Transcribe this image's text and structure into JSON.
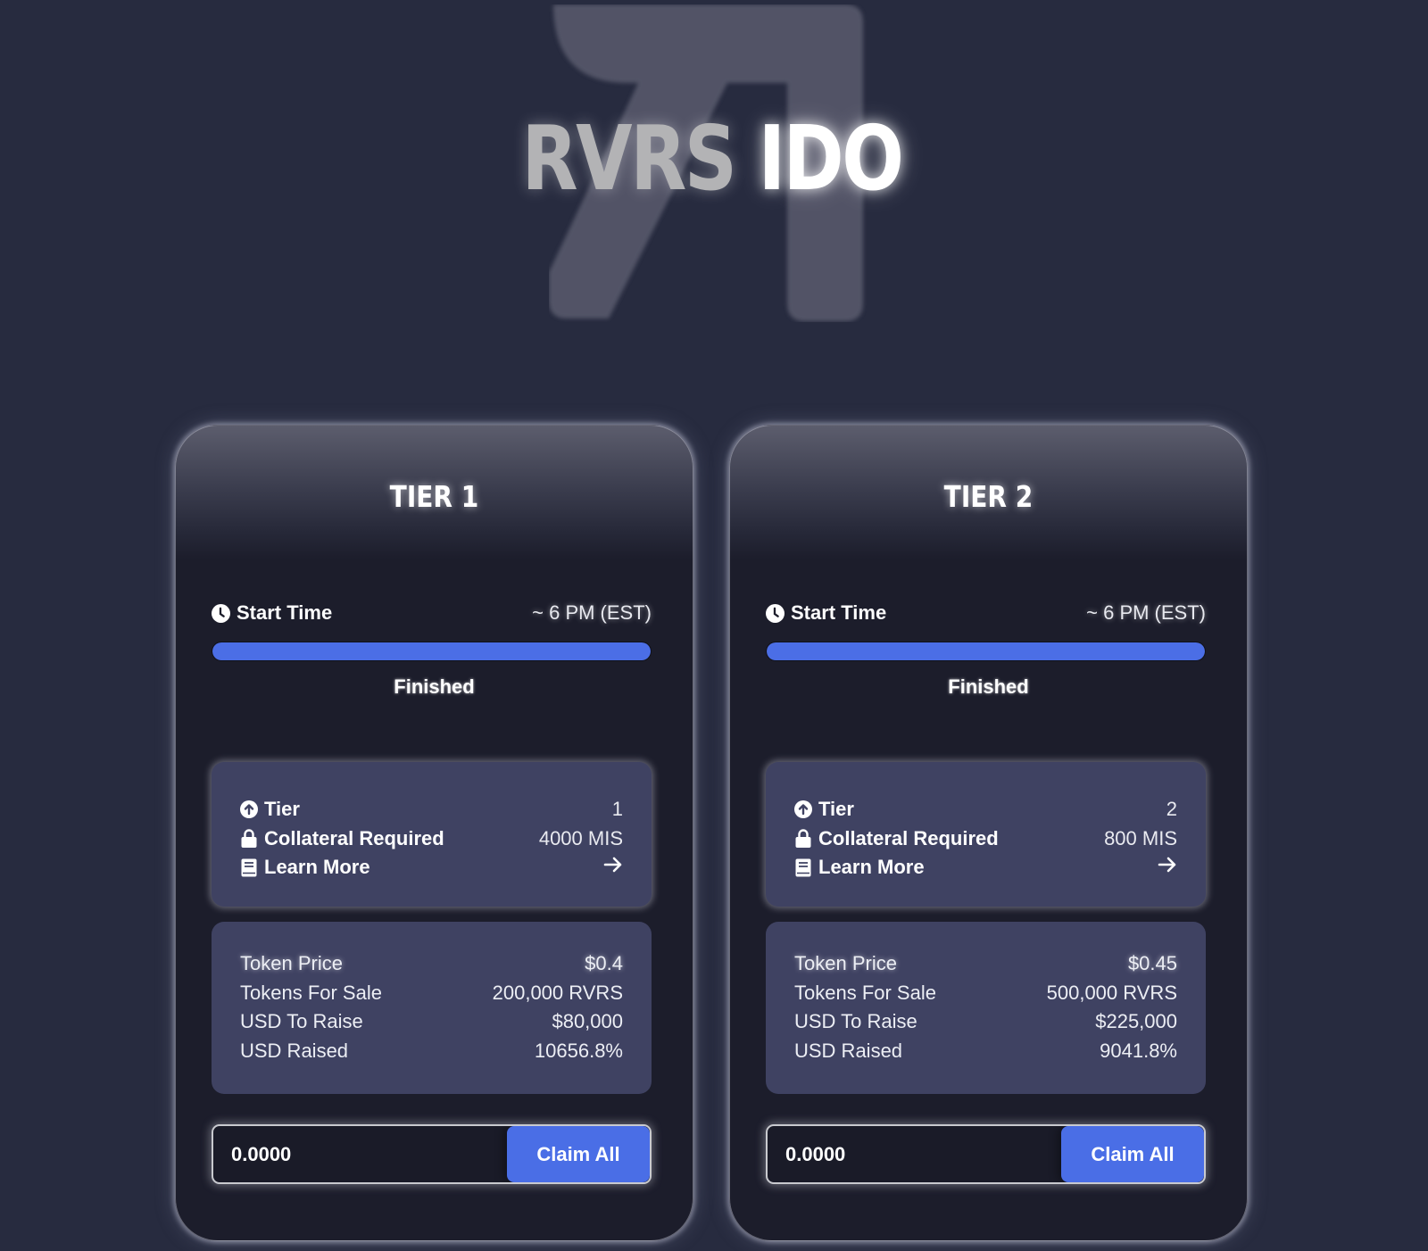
{
  "header": {
    "title_part1": "RVRS",
    "title_part2": "IDO",
    "logo_icon": "rvrs-logo"
  },
  "colors": {
    "background": "#272b3f",
    "card": "#1c1d2b",
    "panel": "#3f4262",
    "accent": "#4a6ee6"
  },
  "tiers": [
    {
      "title": "TIER 1",
      "start_label": "Start Time",
      "start_value": "~ 6 PM (EST)",
      "progress_percent": 100,
      "status": "Finished",
      "info": {
        "tier_label": "Tier",
        "tier_value": "1",
        "collateral_label": "Collateral Required",
        "collateral_value": "4000 MIS",
        "learn_more_label": "Learn More",
        "learn_more_icon": "arrow-right"
      },
      "stats": [
        {
          "label": "Token Price",
          "value": "$0.4"
        },
        {
          "label": "Tokens For Sale",
          "value": "200,000 RVRS"
        },
        {
          "label": "USD To Raise",
          "value": "$80,000"
        },
        {
          "label": "USD Raised",
          "value": "10656.8%"
        }
      ],
      "claim": {
        "amount": "0.0000",
        "button_label": "Claim All"
      }
    },
    {
      "title": "TIER 2",
      "start_label": "Start Time",
      "start_value": "~ 6 PM (EST)",
      "progress_percent": 100,
      "status": "Finished",
      "info": {
        "tier_label": "Tier",
        "tier_value": "2",
        "collateral_label": "Collateral Required",
        "collateral_value": "800 MIS",
        "learn_more_label": "Learn More",
        "learn_more_icon": "arrow-right"
      },
      "stats": [
        {
          "label": "Token Price",
          "value": "$0.45"
        },
        {
          "label": "Tokens For Sale",
          "value": "500,000 RVRS"
        },
        {
          "label": "USD To Raise",
          "value": "$225,000"
        },
        {
          "label": "USD Raised",
          "value": "9041.8%"
        }
      ],
      "claim": {
        "amount": "0.0000",
        "button_label": "Claim All"
      }
    }
  ]
}
